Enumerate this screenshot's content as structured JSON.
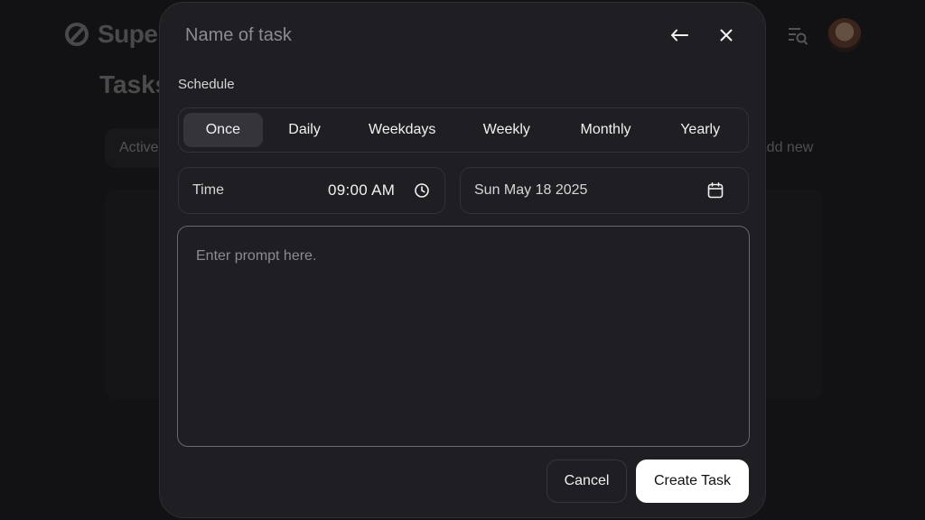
{
  "background": {
    "logo_text": "Super",
    "page_title": "Tasks",
    "tab_label": "Active",
    "add_new_label": "Add new"
  },
  "modal": {
    "task_name_placeholder": "Name of task",
    "back_icon": "arrow-left-icon",
    "close_icon": "close-icon",
    "schedule_label": "Schedule",
    "schedule_options": [
      "Once",
      "Daily",
      "Weekdays",
      "Weekly",
      "Monthly",
      "Yearly"
    ],
    "selected_option": "Once",
    "time_label": "Time",
    "time_value": "09:00 AM",
    "date_value": "Sun May 18 2025",
    "prompt_placeholder": "Enter prompt here.",
    "cancel_label": "Cancel",
    "create_label": "Create Task"
  },
  "colors": {
    "modal_bg": "#1f1e22",
    "active_tab_bg": "#35343a",
    "primary_button_bg": "#ffffff"
  }
}
